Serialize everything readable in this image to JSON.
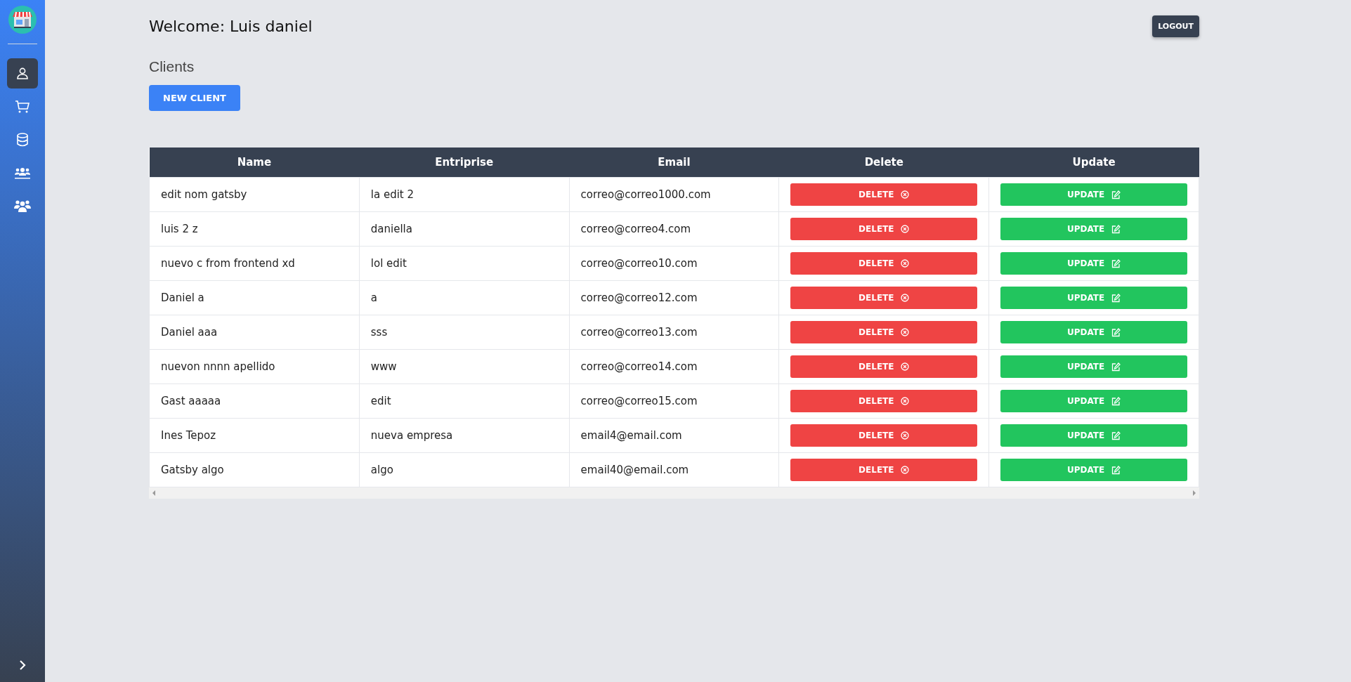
{
  "sidebar": {
    "items": [
      {
        "kind": "user",
        "selected": true
      },
      {
        "kind": "cart",
        "selected": false
      },
      {
        "kind": "database",
        "selected": false
      },
      {
        "kind": "team",
        "selected": false
      },
      {
        "kind": "group",
        "selected": false
      }
    ]
  },
  "header": {
    "welcome": "Welcome: Luis daniel",
    "logout": "LOGOUT"
  },
  "section_title": "Clients",
  "new_button": "NEW CLIENT",
  "table": {
    "columns": [
      "Name",
      "Entriprise",
      "Email",
      "Delete",
      "Update"
    ],
    "rows": [
      {
        "name": "edit nom gatsby",
        "enterprise": "la edit 2",
        "email": "correo@correo1000.com",
        "delete": "DELETE",
        "update": "UPDATE"
      },
      {
        "name": "luis 2 z",
        "enterprise": "daniella",
        "email": "correo@correo4.com",
        "delete": "DELETE",
        "update": "UPDATE"
      },
      {
        "name": "nuevo c from frontend xd",
        "enterprise": "lol edit",
        "email": "correo@correo10.com",
        "delete": "DELETE",
        "update": "UPDATE"
      },
      {
        "name": "Daniel a",
        "enterprise": "a",
        "email": "correo@correo12.com",
        "delete": "DELETE",
        "update": "UPDATE"
      },
      {
        "name": "Daniel aaa",
        "enterprise": "sss",
        "email": "correo@correo13.com",
        "delete": "DELETE",
        "update": "UPDATE"
      },
      {
        "name": "nuevon nnnn apellido",
        "enterprise": "www",
        "email": "correo@correo14.com",
        "delete": "DELETE",
        "update": "UPDATE"
      },
      {
        "name": "Gast aaaaa",
        "enterprise": "edit",
        "email": "correo@correo15.com",
        "delete": "DELETE",
        "update": "UPDATE"
      },
      {
        "name": "Ines Tepoz",
        "enterprise": "nueva empresa",
        "email": "email4@email.com",
        "delete": "DELETE",
        "update": "UPDATE"
      },
      {
        "name": "Gatsby algo",
        "enterprise": "algo",
        "email": "email40@email.com",
        "delete": "DELETE",
        "update": "UPDATE"
      }
    ]
  }
}
